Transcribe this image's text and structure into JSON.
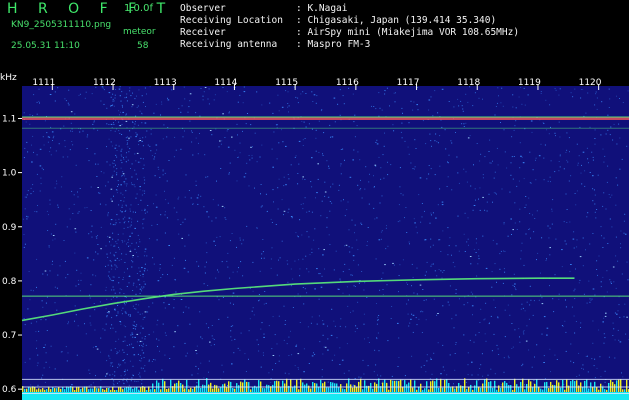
{
  "header": {
    "app_title": "H R O F F T",
    "version": "1.0.0f",
    "filename": "KN9_2505311110.png",
    "tag": "meteor",
    "datetime": "25.05.31 11:10",
    "count": "58"
  },
  "info": [
    {
      "label": "Observer",
      "value": ": K.Nagai"
    },
    {
      "label": "Receiving Location",
      "value": ": Chigasaki, Japan (139.414 35.340)"
    },
    {
      "label": "Receiver",
      "value": ": AirSpy mini (Miakejima VOR 108.65MHz)"
    },
    {
      "label": "Receiving antenna",
      "value": ": Maspro FM-3"
    }
  ],
  "colors": {
    "background": "#10107a",
    "speckle": "#3a8cff",
    "line_green": "#5cf07a",
    "line_red": "#ff5a5a",
    "floor": "#16e8f2",
    "floor_spike": "#f0f020",
    "text": "#ffffff",
    "header_green": "#48e06c"
  },
  "chart_data": {
    "type": "heatmap",
    "ylabel": "kHz",
    "ylim": [
      0.58,
      1.16
    ],
    "yticks": [
      "0.6",
      "0.7",
      "0.8",
      "0.9",
      "1.0",
      "1.1"
    ],
    "xlim": [
      1110.5,
      1120.5
    ],
    "xticks": [
      "1111",
      "1112",
      "1113",
      "1114",
      "1115",
      "1116",
      "1117",
      "1118",
      "1119",
      "1120"
    ],
    "grid": false,
    "series": [
      {
        "style": "band",
        "x": [
          1110.5,
          1120.5
        ],
        "y": [
          1.1,
          1.1
        ]
      },
      {
        "style": "faint",
        "x": [
          1110.5,
          1120.5
        ],
        "y": [
          1.082,
          1.082
        ]
      },
      {
        "style": "constant",
        "x": [
          1110.5,
          1120.5
        ],
        "y": [
          0.772,
          0.772
        ]
      },
      {
        "style": "drift",
        "x": [
          1110.5,
          1111.0,
          1111.5,
          1112.0,
          1112.5,
          1113.0,
          1113.5,
          1114.0,
          1115.0,
          1116.0,
          1117.0,
          1118.0,
          1119.0,
          1119.6
        ],
        "y": [
          0.727,
          0.737,
          0.748,
          0.758,
          0.767,
          0.775,
          0.781,
          0.786,
          0.794,
          0.799,
          0.802,
          0.804,
          0.805,
          0.805
        ]
      },
      {
        "style": "ref",
        "x": [
          1110.5,
          1120.5
        ],
        "y": [
          0.618,
          0.618
        ]
      },
      {
        "style": "ref",
        "x": [
          1110.5,
          1120.5
        ],
        "y": [
          0.604,
          0.604
        ]
      },
      {
        "style": "ref",
        "x": [
          1110.5,
          1120.5
        ],
        "y": [
          0.592,
          0.592
        ]
      }
    ]
  }
}
